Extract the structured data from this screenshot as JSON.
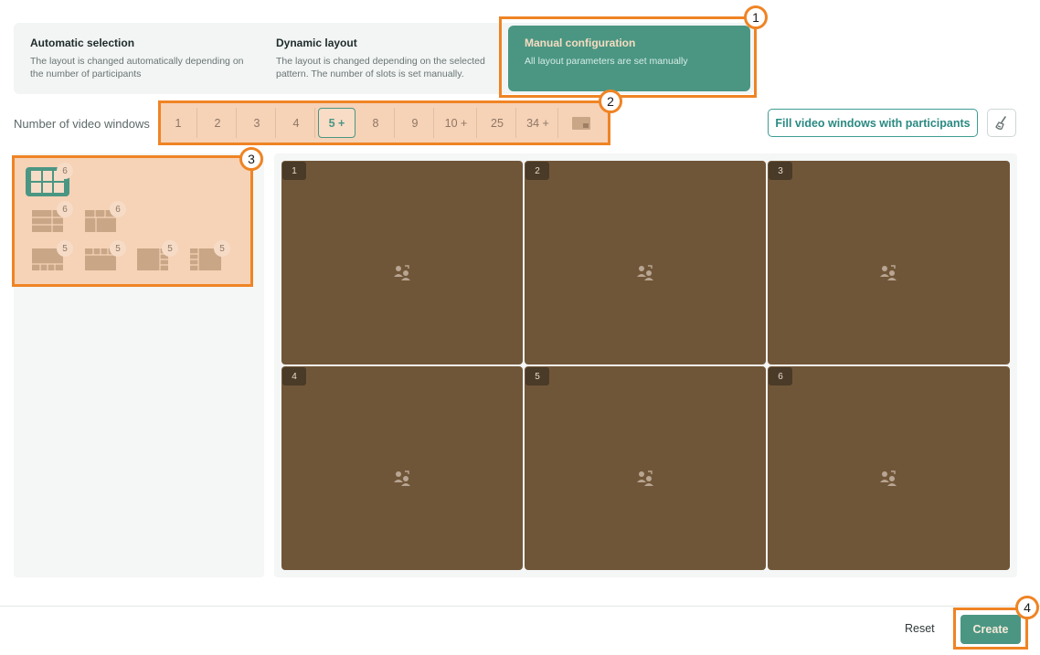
{
  "modes": [
    {
      "title": "Automatic selection",
      "desc": "The layout is changed automatically depending on the number of participants"
    },
    {
      "title": "Dynamic layout",
      "desc": "The layout is changed depending on the selected pattern. The number of slots is set manually."
    },
    {
      "title": "Manual configuration",
      "desc": "All layout parameters are set manually"
    }
  ],
  "windows": {
    "label": "Number of video windows",
    "counts": [
      "1",
      "2",
      "3",
      "4",
      "5 +",
      "8",
      "9",
      "10 +",
      "25",
      "34 +"
    ],
    "selected": "5 +",
    "pip_icon": "picture-in-picture-icon"
  },
  "fill_button": "Fill video windows with participants",
  "clear_icon": "broom-icon",
  "patterns": {
    "badges": [
      "6",
      "6",
      "6",
      "5",
      "5",
      "5",
      "5"
    ]
  },
  "slots": [
    "1",
    "2",
    "3",
    "4",
    "5",
    "6"
  ],
  "slot_icon": "add-participant-icon",
  "footer": {
    "reset": "Reset",
    "create": "Create"
  },
  "callouts": [
    "1",
    "2",
    "3",
    "4"
  ],
  "colors": {
    "accent": "#4a9683",
    "highlight": "#ef8424",
    "slot": "#705638",
    "panel_highlight": "#f6d2b7"
  }
}
